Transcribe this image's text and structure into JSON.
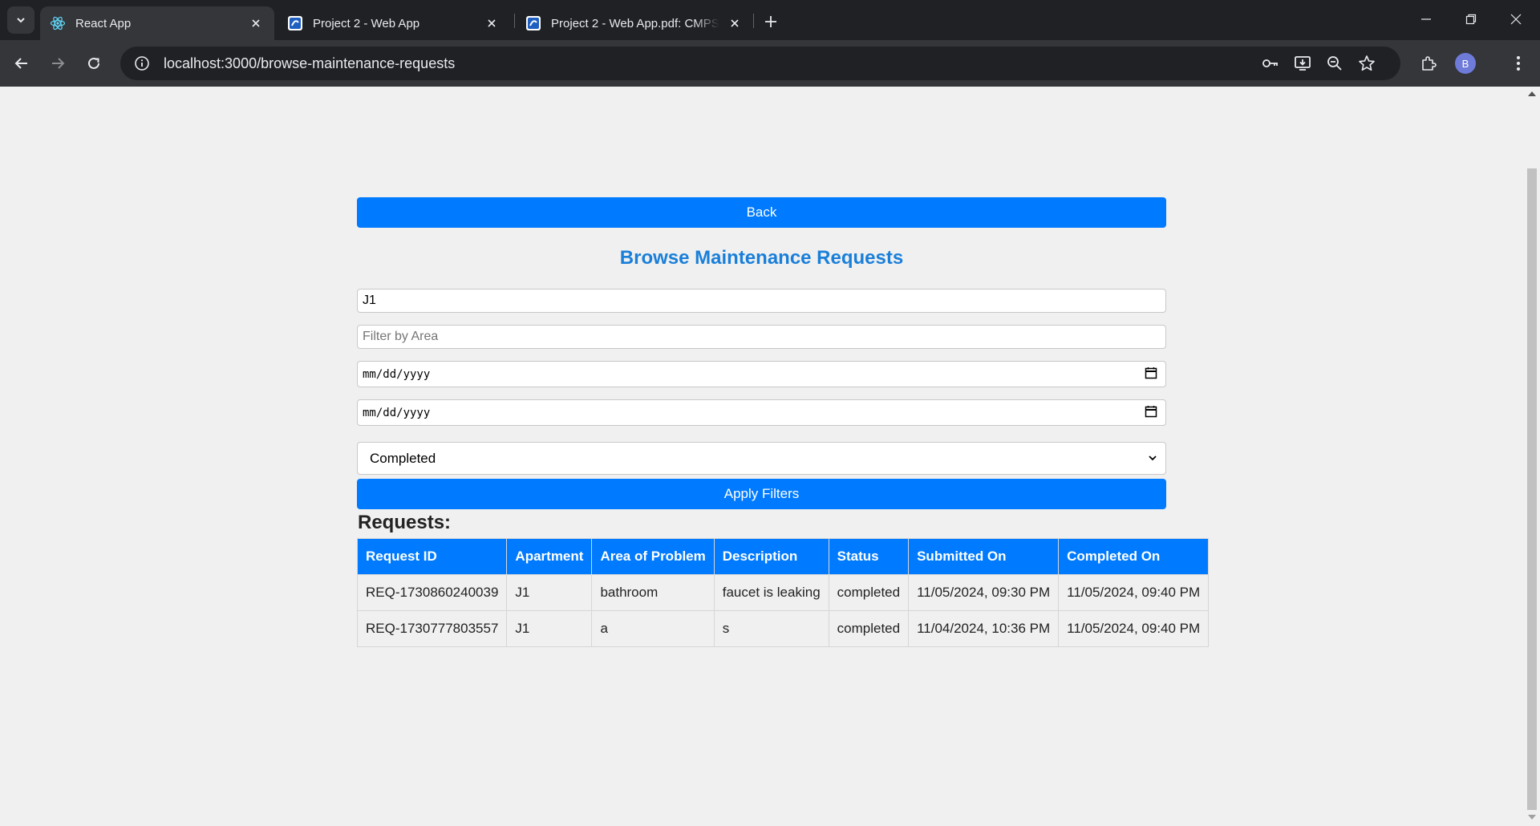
{
  "browser": {
    "tabs": [
      {
        "title": "React App",
        "favicon": "react-icon",
        "active": true
      },
      {
        "title": "Project 2 - Web App",
        "favicon": "pdf-app-icon",
        "active": false
      },
      {
        "title": "Project 2 - Web App.pdf: CMPS",
        "favicon": "pdf-app-icon",
        "active": false
      }
    ],
    "url": "localhost:3000/browse-maintenance-requests",
    "profile_initial": "B"
  },
  "page": {
    "back_label": "Back",
    "title": "Browse Maintenance Requests",
    "filters": {
      "apartment_value": "J1",
      "area_placeholder": "Filter by Area",
      "start_date_placeholder": "mm/dd/yyyy",
      "end_date_placeholder": "mm/dd/yyyy",
      "status_selected": "Completed",
      "apply_label": "Apply Filters"
    },
    "requests_heading": "Requests:",
    "table": {
      "headers": [
        "Request ID",
        "Apartment",
        "Area of Problem",
        "Description",
        "Status",
        "Submitted On",
        "Completed On"
      ],
      "rows": [
        [
          "REQ-1730860240039",
          "J1",
          "bathroom",
          "faucet is leaking",
          "completed",
          "11/05/2024, 09:30 PM",
          "11/05/2024, 09:40 PM"
        ],
        [
          "REQ-1730777803557",
          "J1",
          "a",
          "s",
          "completed",
          "11/04/2024, 10:36 PM",
          "11/05/2024, 09:40 PM"
        ]
      ]
    }
  },
  "colors": {
    "primary": "#007bff",
    "title": "#1a7fd9",
    "page_bg": "#f0f0f0",
    "chrome_dark": "#202124",
    "chrome_toolbar": "#35363a"
  }
}
